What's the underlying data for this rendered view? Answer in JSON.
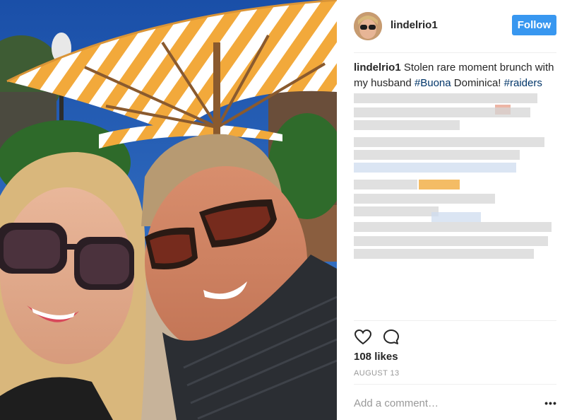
{
  "post": {
    "photo_icon": "post-photo",
    "image_alt": "Selfie of a couple in sunglasses under a striped patio umbrella"
  },
  "header": {
    "avatar_icon": "avatar",
    "username": "lindelrio1",
    "follow_label": "Follow"
  },
  "caption": {
    "username": "lindelrio1",
    "text_before": " Stolen rare moment brunch with my husband ",
    "hashtag1": "#Buona",
    "text_middle": " Dominica! ",
    "hashtag2": "#raiders"
  },
  "actions": {
    "like_icon": "heart-icon",
    "comment_icon": "comment-icon"
  },
  "likes": "108 likes",
  "date": "AUGUST 13",
  "comment": {
    "placeholder": "Add a comment…",
    "more_icon": "more-options-icon",
    "more_glyph": "•••"
  },
  "colors": {
    "follow_button": "#3897f0",
    "hashtag": "#003569",
    "umbrella_stripe": "#f2a93b",
    "sky": "#1f5fb3"
  }
}
